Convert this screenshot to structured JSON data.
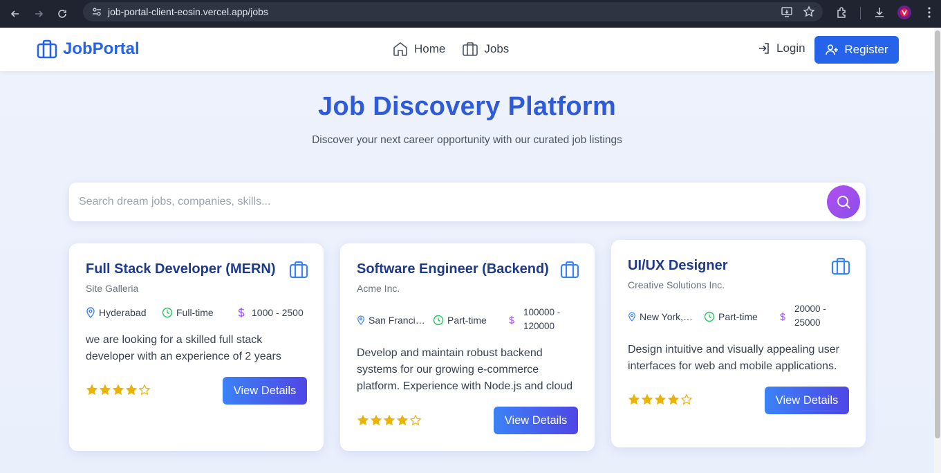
{
  "browser": {
    "url": "job-portal-client-eosin.vercel.app/jobs"
  },
  "header": {
    "logo": "JobPortal",
    "nav": [
      {
        "label": "Home",
        "icon": "home-icon"
      },
      {
        "label": "Jobs",
        "icon": "briefcase-icon"
      }
    ],
    "login": "Login",
    "register": "Register"
  },
  "hero": {
    "title": "Job Discovery Platform",
    "subtitle": "Discover your next career opportunity with our curated job listings"
  },
  "search": {
    "placeholder": "Search dream jobs, companies, skills..."
  },
  "colors": {
    "brand": "#2563eb",
    "title": "#1e3a8a",
    "star": "#eab308",
    "search_button": "#a34ff0"
  },
  "jobs": [
    {
      "title": "Full Stack Developer (MERN)",
      "company": "Site Galleria",
      "location": "Hyderabad",
      "type": "Full-time",
      "salary": "1000 - 2500",
      "description": "we are looking for a skilled full stack developer with an experience of 2 years",
      "rating": 4,
      "button": "View Details"
    },
    {
      "title": "Software Engineer (Backend)",
      "company": "Acme Inc.",
      "location": "San Francisco, CA",
      "type": "Part-time",
      "salary_line1": "100000 -",
      "salary_line2": "120000",
      "description": "Develop and maintain robust backend systems for our growing e-commerce platform. Experience with Node.js and cloud services required.",
      "rating": 4,
      "button": "View Details"
    },
    {
      "title": "UI/UX Designer",
      "company": "Creative Solutions Inc.",
      "location": "New York, NY",
      "type": "Part-time",
      "salary_line1": "20000 -",
      "salary_line2": "25000",
      "description": "Design intuitive and visually appealing user interfaces for web and mobile applications.",
      "rating": 4,
      "button": "View Details"
    }
  ]
}
